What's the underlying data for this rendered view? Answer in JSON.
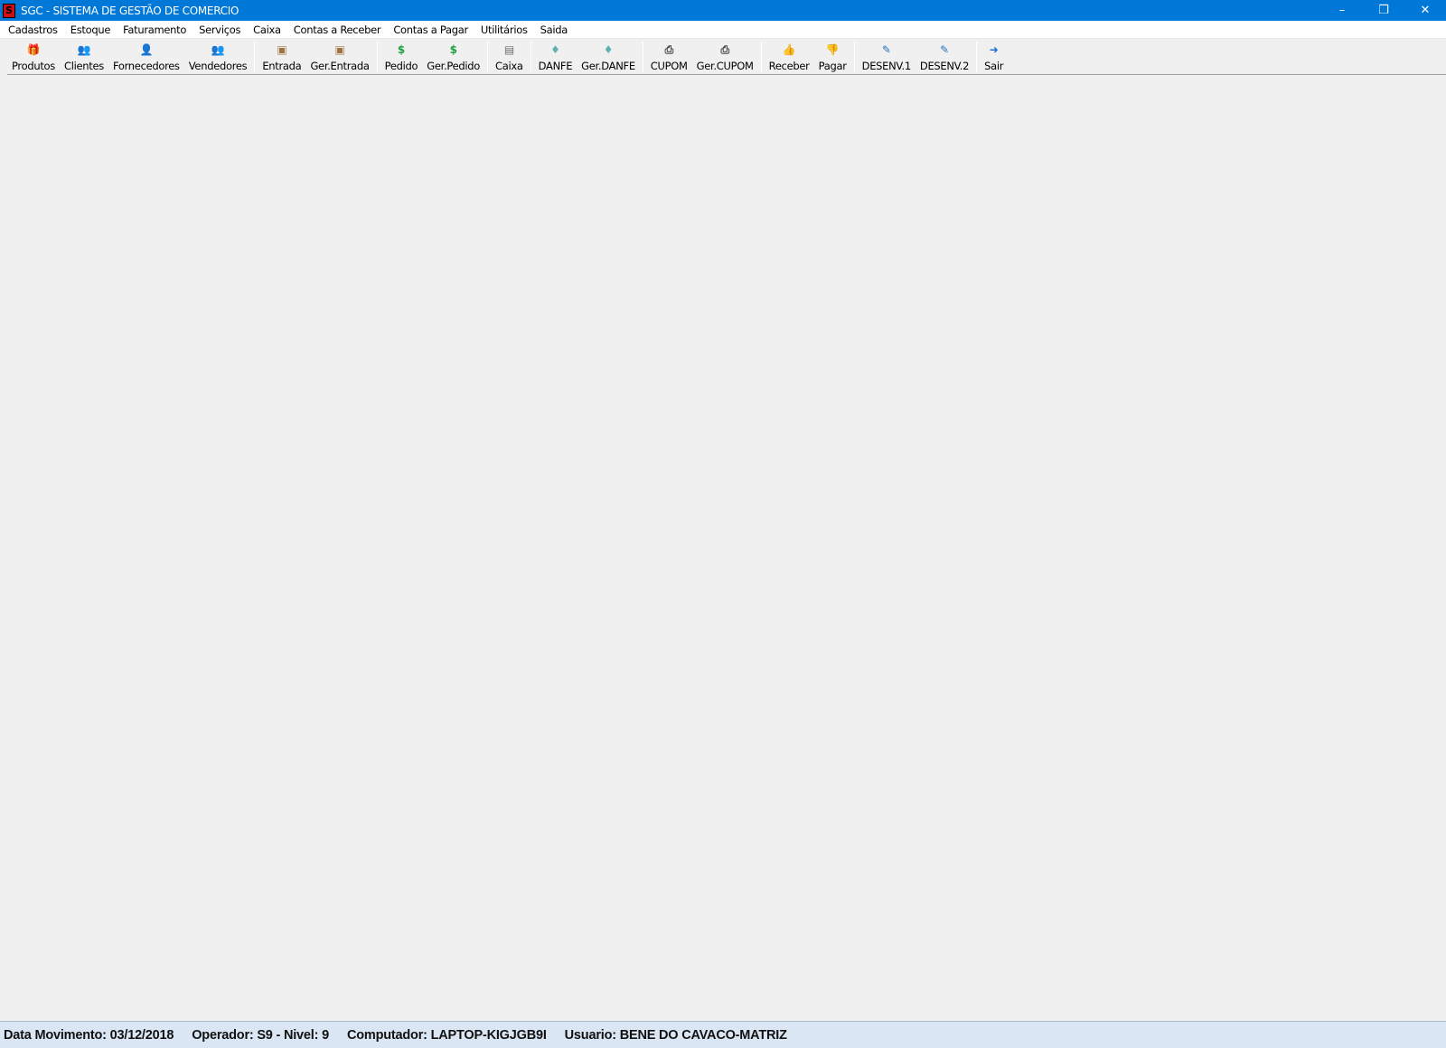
{
  "window": {
    "title": "SGC - SISTEMA DE GESTÃO DE COMERCIO",
    "app_icon_letter": "S",
    "minimize": "–",
    "restore": "❐",
    "close": "✕"
  },
  "menu": [
    "Cadastros",
    "Estoque",
    "Faturamento",
    "Serviços",
    "Caixa",
    "Contas a Receber",
    "Contas a Pagar",
    "Utilitários",
    "Saida"
  ],
  "toolbar": {
    "groups": [
      [
        {
          "label": "Produtos",
          "icon": "gift-icon",
          "glyph": "🎁",
          "color": "#d04040"
        },
        {
          "label": "Clientes",
          "icon": "users-icon",
          "glyph": "👥",
          "color": "#e07020"
        },
        {
          "label": "Fornecedores",
          "icon": "supplier-icon",
          "glyph": "👤",
          "color": "#333333"
        },
        {
          "label": "Vendedores",
          "icon": "sellers-icon",
          "glyph": "👥",
          "color": "#d03030"
        }
      ],
      [
        {
          "label": "Entrada",
          "icon": "entry-box-icon",
          "glyph": "▣",
          "color": "#a07040"
        },
        {
          "label": "Ger.Entrada",
          "icon": "entry-manage-icon",
          "glyph": "▣",
          "color": "#a07040"
        }
      ],
      [
        {
          "label": "Pedido",
          "icon": "dollar-icon",
          "glyph": "$",
          "color": "#20a040"
        },
        {
          "label": "Ger.Pedido",
          "icon": "dollar-manage-icon",
          "glyph": "$",
          "color": "#20a040"
        }
      ],
      [
        {
          "label": "Caixa",
          "icon": "cash-register-icon",
          "glyph": "▤",
          "color": "#707070"
        }
      ],
      [
        {
          "label": "DANFE",
          "icon": "danfe-icon",
          "glyph": "♦",
          "color": "#60b0b0"
        },
        {
          "label": "Ger.DANFE",
          "icon": "danfe-manage-icon",
          "glyph": "♦",
          "color": "#60b0b0"
        }
      ],
      [
        {
          "label": "CUPOM",
          "icon": "printer-icon",
          "glyph": "⎙",
          "color": "#404040"
        },
        {
          "label": "Ger.CUPOM",
          "icon": "printer-manage-icon",
          "glyph": "⎙",
          "color": "#404040"
        }
      ],
      [
        {
          "label": "Receber",
          "icon": "thumbs-up-icon",
          "glyph": "👍",
          "color": "#30a030"
        },
        {
          "label": "Pagar",
          "icon": "thumbs-down-icon",
          "glyph": "👎",
          "color": "#e02020"
        }
      ],
      [
        {
          "label": "DESENV.1",
          "icon": "developer-icon",
          "glyph": "✎",
          "color": "#3070c0"
        },
        {
          "label": "DESENV.2",
          "icon": "developer-2-icon",
          "glyph": "✎",
          "color": "#3070c0"
        }
      ],
      [
        {
          "label": "Sair",
          "icon": "exit-door-icon",
          "glyph": "➜",
          "color": "#2070d0"
        }
      ]
    ]
  },
  "status": {
    "data_movimento": "Data Movimento: 03/12/2018",
    "operador": "Operador: S9 - Nivel: 9",
    "computador": "Computador: LAPTOP-KIGJGB9I",
    "usuario": "Usuario: BENE DO CAVACO-MATRIZ"
  }
}
